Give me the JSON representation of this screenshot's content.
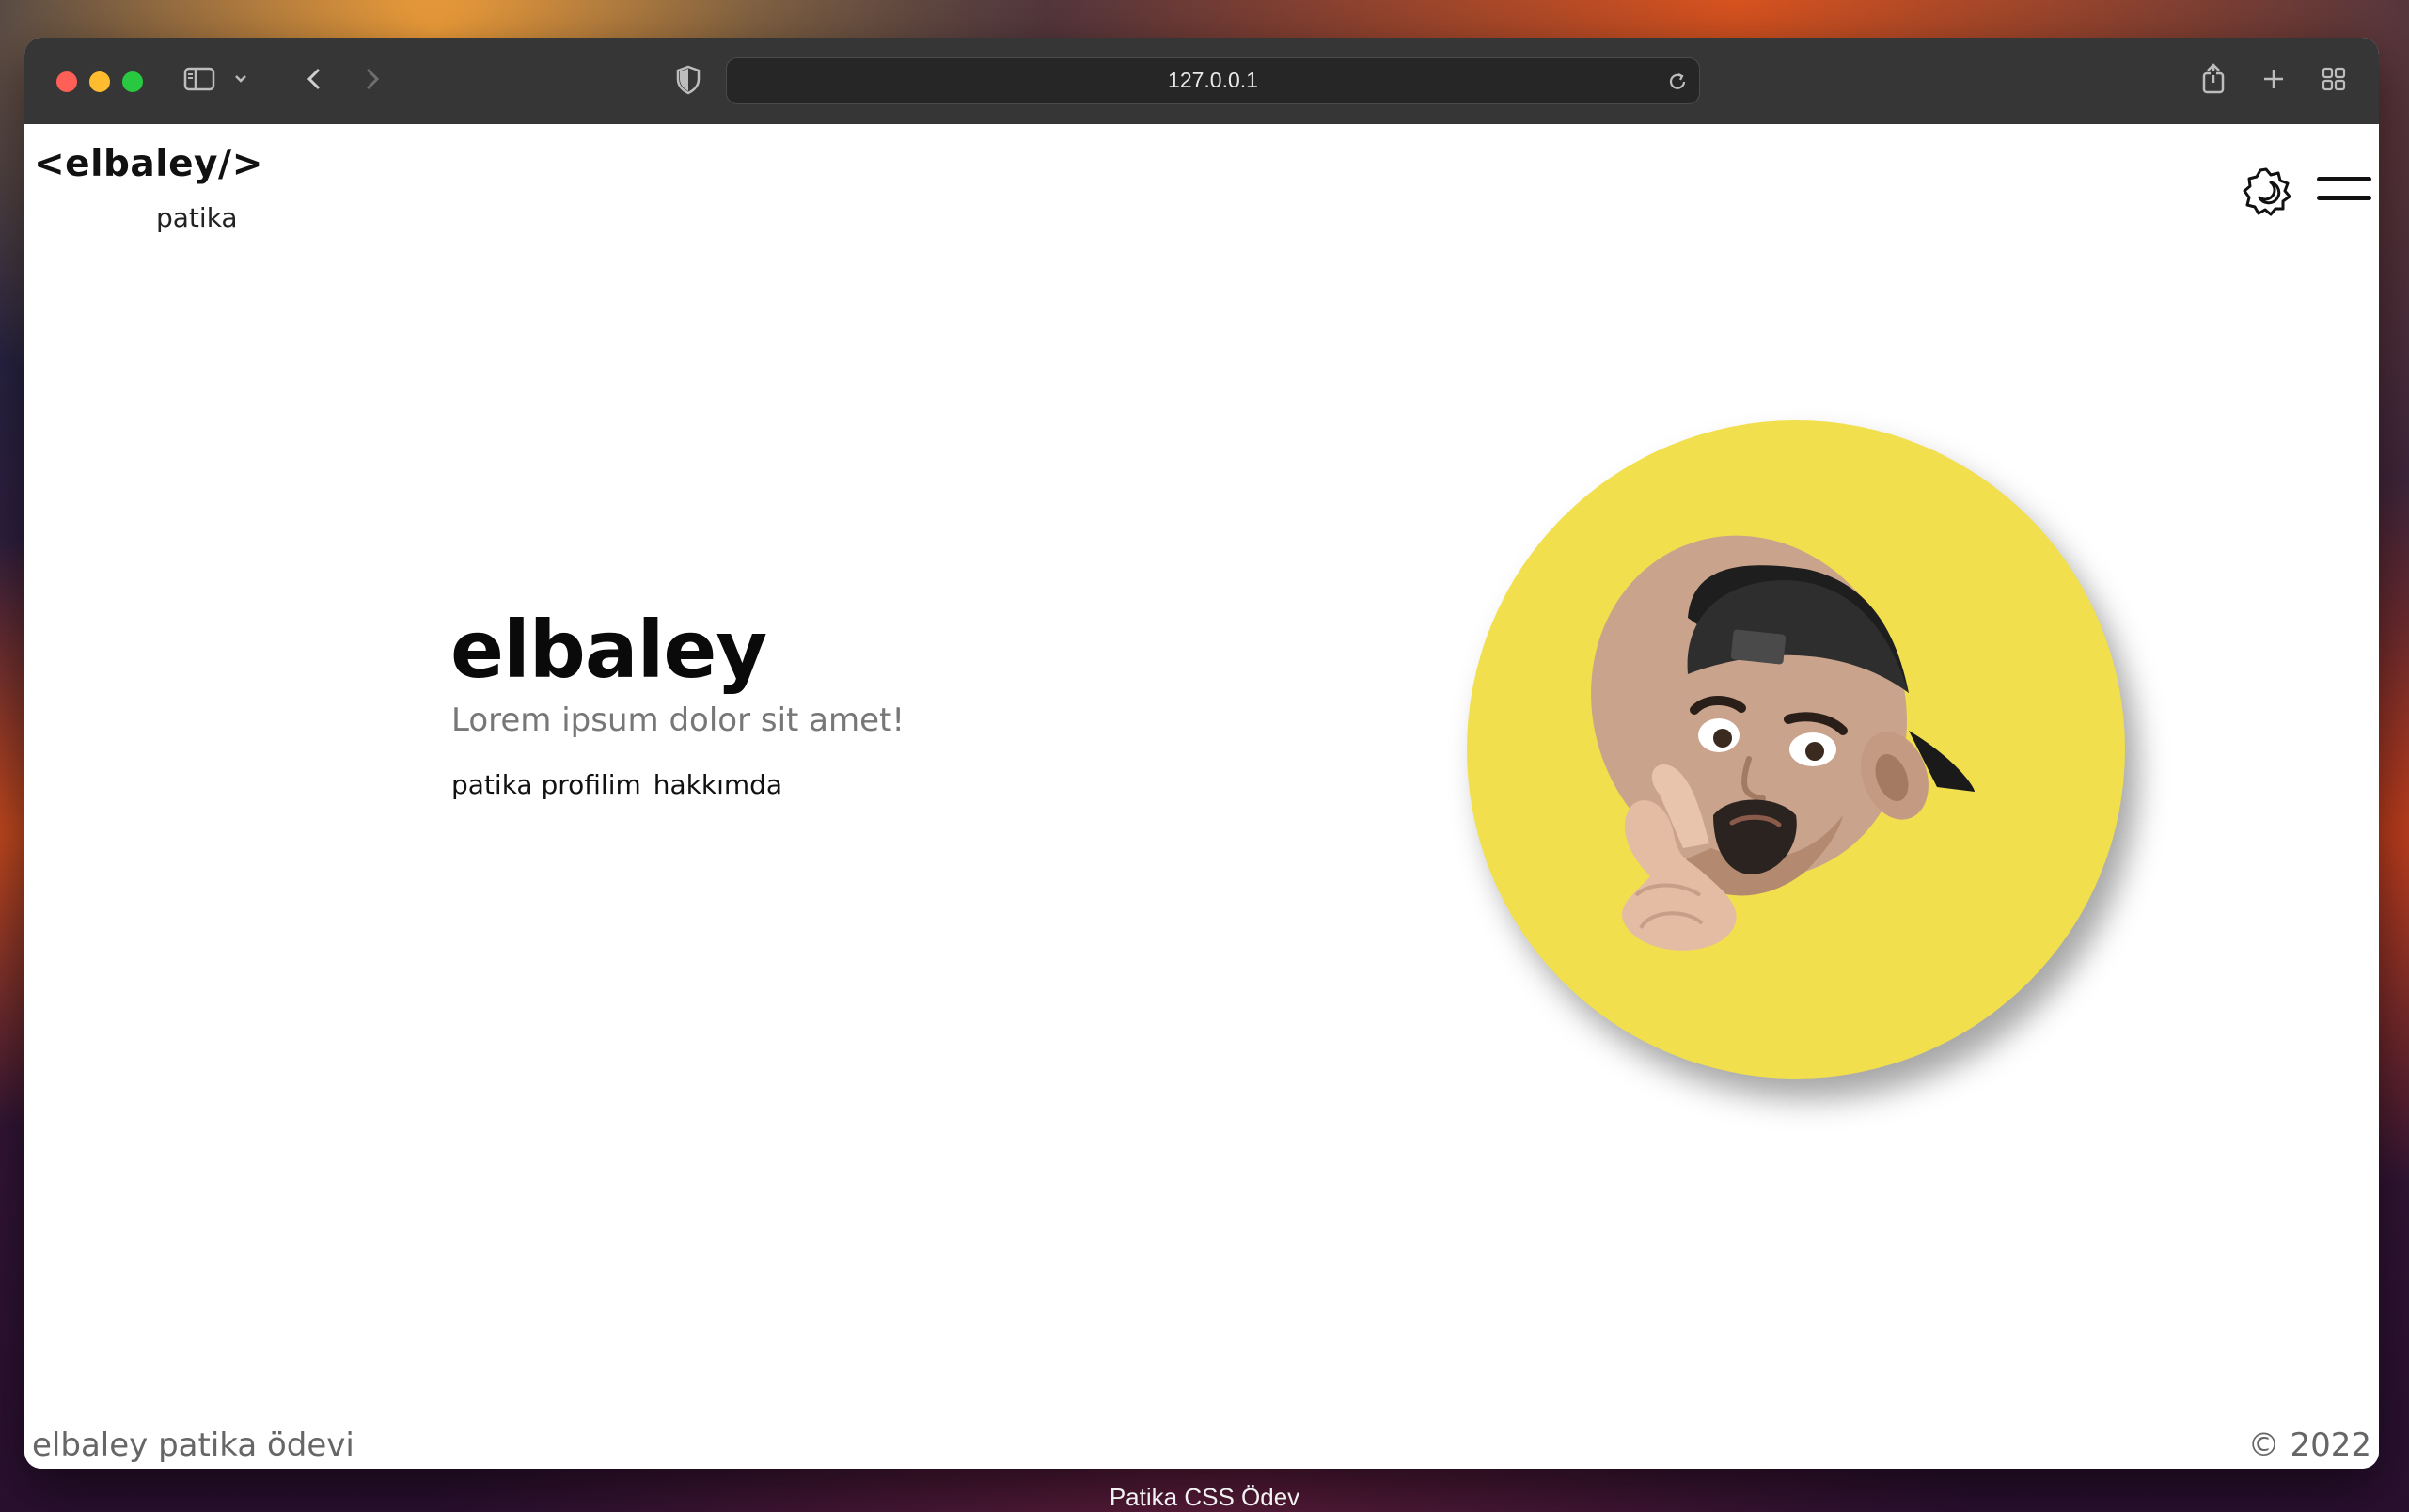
{
  "browser": {
    "url": "127.0.0.1",
    "tab_caption": "Patika CSS Ödev"
  },
  "header": {
    "logo": "<elbaley/>",
    "logo_sub": "patika"
  },
  "hero": {
    "title": "elbaley",
    "subtitle": "Lorem ipsum dolor sit amet!",
    "links": [
      "patika profilim",
      "hakkımda"
    ],
    "avatar_bg": "#f1df4d"
  },
  "footer": {
    "left": "elbaley patika ödevi",
    "right": "© 2022"
  },
  "icons": {
    "theme": "theme-toggle-icon",
    "menu": "hamburger-menu-icon"
  }
}
